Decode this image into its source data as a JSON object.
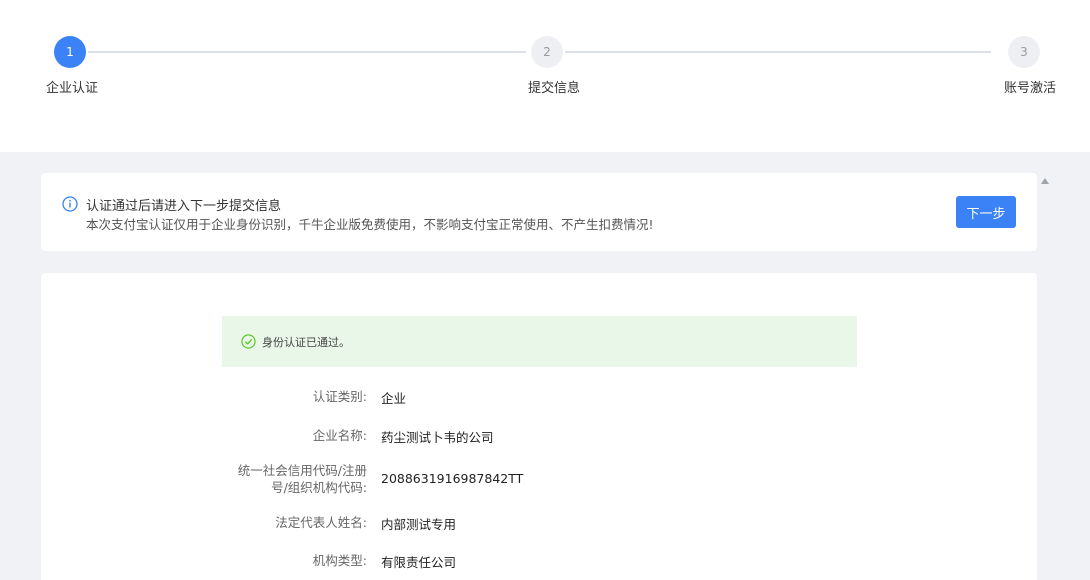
{
  "steps": [
    {
      "number": "1",
      "label": "企业认证",
      "active": true
    },
    {
      "number": "2",
      "label": "提交信息",
      "active": false
    },
    {
      "number": "3",
      "label": "账号激活",
      "active": false
    }
  ],
  "notice": {
    "title": "认证通过后请进入下一步提交信息",
    "subtitle": "本次支付宝认证仅用于企业身份识别，千牛企业版免费使用，不影响支付宝正常使用、不产生扣费情况!",
    "next_label": "下一步"
  },
  "status": {
    "text": "身份认证已通过。"
  },
  "fields": [
    {
      "label": "认证类别:",
      "value": "企业"
    },
    {
      "label": "企业名称:",
      "value": "药尘测试卜韦的公司"
    },
    {
      "label_line1": "统一社会信用代码/注册",
      "label_line2": "号/组织机构代码:",
      "value": "2088631916987842TT"
    },
    {
      "label": "法定代表人姓名:",
      "value": "内部测试专用"
    },
    {
      "label": "机构类型:",
      "value": "有限责任公司"
    }
  ],
  "colors": {
    "primary": "#3b82f6",
    "success_bg": "#e9f7e8",
    "page_bg": "#f0f2f5"
  }
}
